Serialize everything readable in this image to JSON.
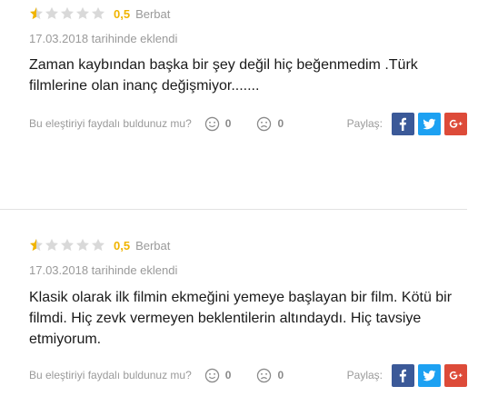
{
  "reviews": [
    {
      "rating": 0.5,
      "rating_text": "0,5",
      "rating_label": "Berbat",
      "date": "17.03.2018 tarihinde eklendi",
      "text": "Zaman kaybından başka bir şey değil hiç beğenmedim .Türk filmlerine olan inanç değişmiyor.......",
      "helpful_question": "Bu eleştiriyi faydalı buldunuz mu?",
      "upvotes": "0",
      "downvotes": "0",
      "share_label": "Paylaş:"
    },
    {
      "rating": 0.5,
      "rating_text": "0,5",
      "rating_label": "Berbat",
      "date": "17.03.2018 tarihinde eklendi",
      "text": "Klasik olarak ilk filmin ekmeğini yemeye başlayan bir film. Kötü bir filmdi. Hiç zevk vermeyen beklentilerin altındaydı. Hiç tavsiye etmiyorum.",
      "helpful_question": "Bu eleştiriyi faydalı buldunuz mu?",
      "upvotes": "0",
      "downvotes": "0",
      "share_label": "Paylaş:"
    }
  ],
  "icons": {
    "star_filled": "star-icon",
    "star_empty": "star-outline-icon",
    "upvote": "smile-icon",
    "downvote": "frown-icon",
    "facebook": "facebook-icon",
    "twitter": "twitter-icon",
    "googleplus": "google-plus-icon"
  },
  "colors": {
    "star": "#f0b400",
    "star_empty": "#d9d9d9",
    "facebook": "#3b5998",
    "twitter": "#1da1f2",
    "googleplus": "#dd4b39"
  }
}
